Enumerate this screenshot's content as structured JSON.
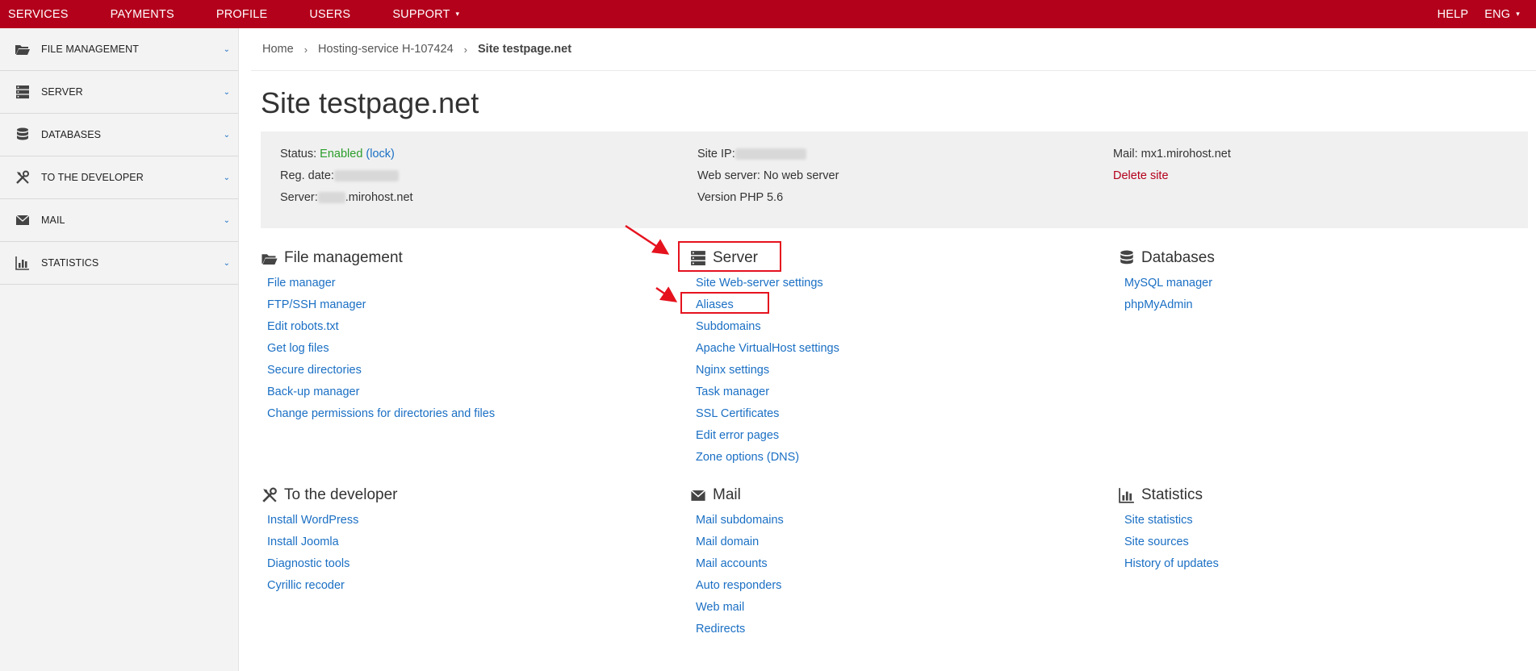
{
  "topnav": {
    "left": [
      "SERVICES",
      "PAYMENTS",
      "PROFILE",
      "USERS",
      "SUPPORT"
    ],
    "right": [
      "HELP",
      "ENG"
    ]
  },
  "sidebar": {
    "items": [
      {
        "label": "FILE MANAGEMENT",
        "icon": "folder-icon"
      },
      {
        "label": "SERVER",
        "icon": "server-icon"
      },
      {
        "label": "DATABASES",
        "icon": "database-icon"
      },
      {
        "label": "TO THE DEVELOPER",
        "icon": "tools-icon"
      },
      {
        "label": "MAIL",
        "icon": "envelope-icon"
      },
      {
        "label": "STATISTICS",
        "icon": "bar-chart-icon"
      }
    ]
  },
  "breadcrumb": {
    "home": "Home",
    "service": "Hosting-service H-107424",
    "current": "Site testpage.net"
  },
  "page_title": "Site testpage.net",
  "info": {
    "status_label": "Status:",
    "status_value": "Enabled",
    "lock": "(lock)",
    "reg_label": "Reg. date:",
    "server_label": "Server:",
    "server_suffix": ".mirohost.net",
    "site_ip_label": "Site IP:",
    "web_server": "Web server: No web server",
    "php": "Version PHP 5.6",
    "mail": "Mail: mx1.mirohost.net",
    "delete": "Delete site"
  },
  "sections": {
    "file_management": {
      "title": "File management",
      "links": [
        "File manager",
        "FTP/SSH manager",
        "Edit robots.txt",
        "Get log files",
        "Secure directories",
        "Back-up manager",
        "Change permissions for directories and files"
      ]
    },
    "server": {
      "title": "Server",
      "links": [
        "Site Web-server settings",
        "Aliases",
        "Subdomains",
        "Apache VirtualHost settings",
        "Nginx settings",
        "Task manager",
        "SSL Certificates",
        "Edit error pages",
        "Zone options (DNS)"
      ]
    },
    "databases": {
      "title": "Databases",
      "links": [
        "MySQL manager",
        "phpMyAdmin"
      ]
    },
    "developer": {
      "title": "To the developer",
      "links": [
        "Install WordPress",
        "Install Joomla",
        "Diagnostic tools",
        "Cyrillic recoder"
      ]
    },
    "mail": {
      "title": "Mail",
      "links": [
        "Mail subdomains",
        "Mail domain",
        "Mail accounts",
        "Auto responders",
        "Web mail",
        "Redirects"
      ]
    },
    "statistics": {
      "title": "Statistics",
      "links": [
        "Site statistics",
        "Site sources",
        "History of updates"
      ]
    }
  },
  "colors": {
    "brand": "#b3001b",
    "link": "#1a6fc4",
    "annotation": "#e5121e"
  }
}
